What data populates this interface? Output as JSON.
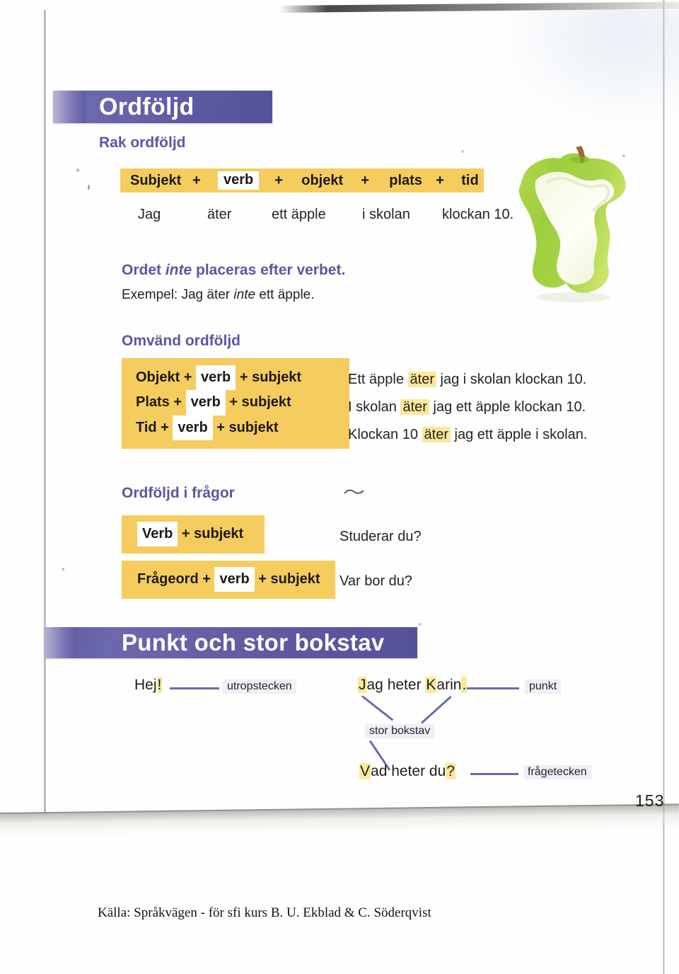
{
  "page": {
    "number": "153",
    "source_caption": "Källa: Språkvägen  - för sfi kurs B. U. Ekblad & C. Söderqvist"
  },
  "colors": {
    "band_purple": "#605ca2",
    "heading_purple": "#5a57a4",
    "formula_yellow": "#f5cc5e",
    "highlight_yellow": "#fbe89a",
    "label_bg": "#eef0f7",
    "connector_purple": "#6d6aae",
    "apple_green": "#9ccf3e"
  },
  "sections": {
    "ordfoljd": {
      "band_title": "Ordföljd",
      "rak": {
        "heading": "Rak ordföljd",
        "formula": [
          {
            "text": "Subjekt",
            "style": "plain"
          },
          {
            "text": "+",
            "style": "plus"
          },
          {
            "text": "verb",
            "style": "white"
          },
          {
            "text": "+",
            "style": "plus"
          },
          {
            "text": "objekt",
            "style": "plain"
          },
          {
            "text": "+",
            "style": "plus"
          },
          {
            "text": "plats",
            "style": "plain"
          },
          {
            "text": "+",
            "style": "plus"
          },
          {
            "text": "tid",
            "style": "plain"
          }
        ],
        "example_words": [
          "Jag",
          "äter",
          "ett äpple",
          "i skolan",
          "klockan 10."
        ]
      },
      "inte_rule": {
        "heading_part1": "Ordet ",
        "heading_italic": "inte",
        "heading_part2": " placeras efter verbet.",
        "example_prefix": "Exempel: Jag äter ",
        "example_italic": "inte",
        "example_suffix": " ett äpple."
      },
      "omvand": {
        "heading": "Omvänd ordföljd",
        "formulas": [
          {
            "a": "Objekt  + ",
            "verb": "verb",
            "b": " + subjekt"
          },
          {
            "a": "Plats + ",
            "verb": "verb",
            "b": "  + subjekt"
          },
          {
            "a": "Tid + ",
            "verb": "verb",
            "b": "  + subjekt"
          }
        ],
        "examples": [
          {
            "pre": "Ett äpple ",
            "hl": "äter",
            "post": " jag i skolan klockan 10."
          },
          {
            "pre": "I skolan ",
            "hl": "äter",
            "post": " jag ett äpple klockan 10."
          },
          {
            "pre": "Klockan 10 ",
            "hl": "äter",
            "post": " jag ett äpple i skolan."
          }
        ]
      },
      "fragor": {
        "heading": "Ordföljd i frågor",
        "rows": [
          {
            "formula_pre": "",
            "formula_verb": "Verb",
            "formula_post": "  + subjekt",
            "example": "Studerar du?"
          },
          {
            "formula_pre": "Frågeord + ",
            "formula_verb": "verb",
            "formula_post": "  + subjekt",
            "example": "Var bor du?"
          }
        ]
      }
    },
    "punkt": {
      "band_title": "Punkt och stor bokstav",
      "items": {
        "hej": {
          "plain": "Hej",
          "mark": "!"
        },
        "utropstecken_label": "utropstecken",
        "karin": {
          "cap1": "J",
          "mid1": "ag heter ",
          "cap2": "K",
          "mid2": "arin",
          "mark": "."
        },
        "punkt_label": "punkt",
        "stor_bokstav_label": "stor bokstav",
        "vad": {
          "cap1": "V",
          "mid1": "ad heter du",
          "mark": "?"
        },
        "fragetecken_label": "frågetecken"
      }
    }
  },
  "icons": {
    "apple": "apple-core-icon"
  }
}
